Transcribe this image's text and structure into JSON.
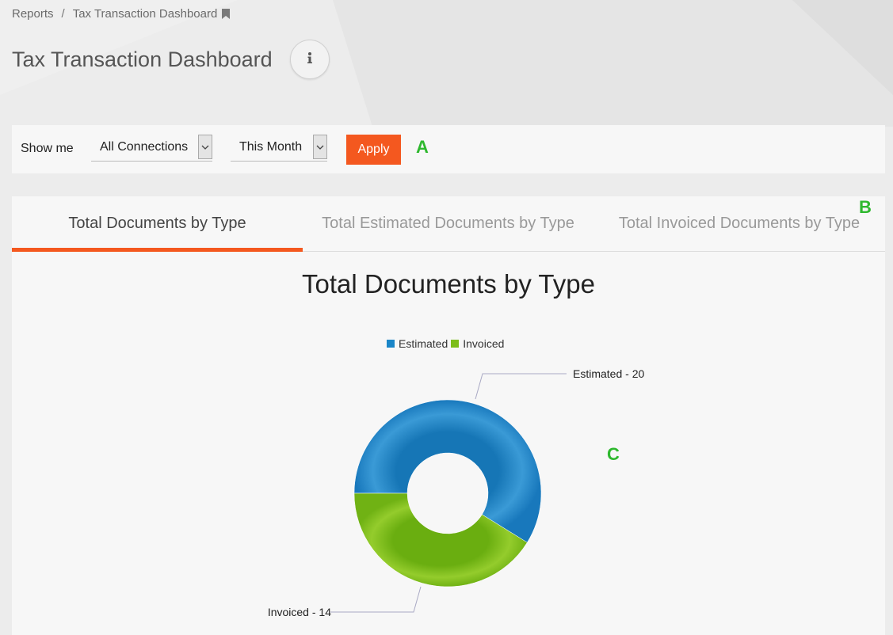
{
  "breadcrumb": {
    "root": "Reports",
    "separator": "/",
    "current": "Tax Transaction Dashboard"
  },
  "page_title": "Tax Transaction Dashboard",
  "filters": {
    "label": "Show me",
    "connection": "All Connections",
    "period": "This Month",
    "apply_label": "Apply"
  },
  "markers": {
    "a": "A",
    "b": "B",
    "c": "C"
  },
  "tabs": [
    {
      "label": "Total Documents by Type",
      "active": true
    },
    {
      "label": "Total Estimated Documents by Type",
      "active": false
    },
    {
      "label": "Total Invoiced Documents by Type",
      "active": false
    }
  ],
  "icons": {
    "breadcrumb": "bookmark-icon",
    "info": "info-icon",
    "dropdown": "chevron-down-icon"
  },
  "colors": {
    "accent": "#f4581f",
    "estimated": "#1a86c8",
    "invoiced": "#7dbd1a",
    "marker": "#2eb82e"
  },
  "chart_data": {
    "type": "pie",
    "title": "Total Documents by Type",
    "donut": true,
    "legend_position": "top",
    "series": [
      {
        "name": "Estimated",
        "value": 20,
        "label": "Estimated - 20",
        "color": "#1a86c8"
      },
      {
        "name": "Invoiced",
        "value": 14,
        "label": "Invoiced - 14",
        "color": "#7dbd1a"
      }
    ]
  }
}
